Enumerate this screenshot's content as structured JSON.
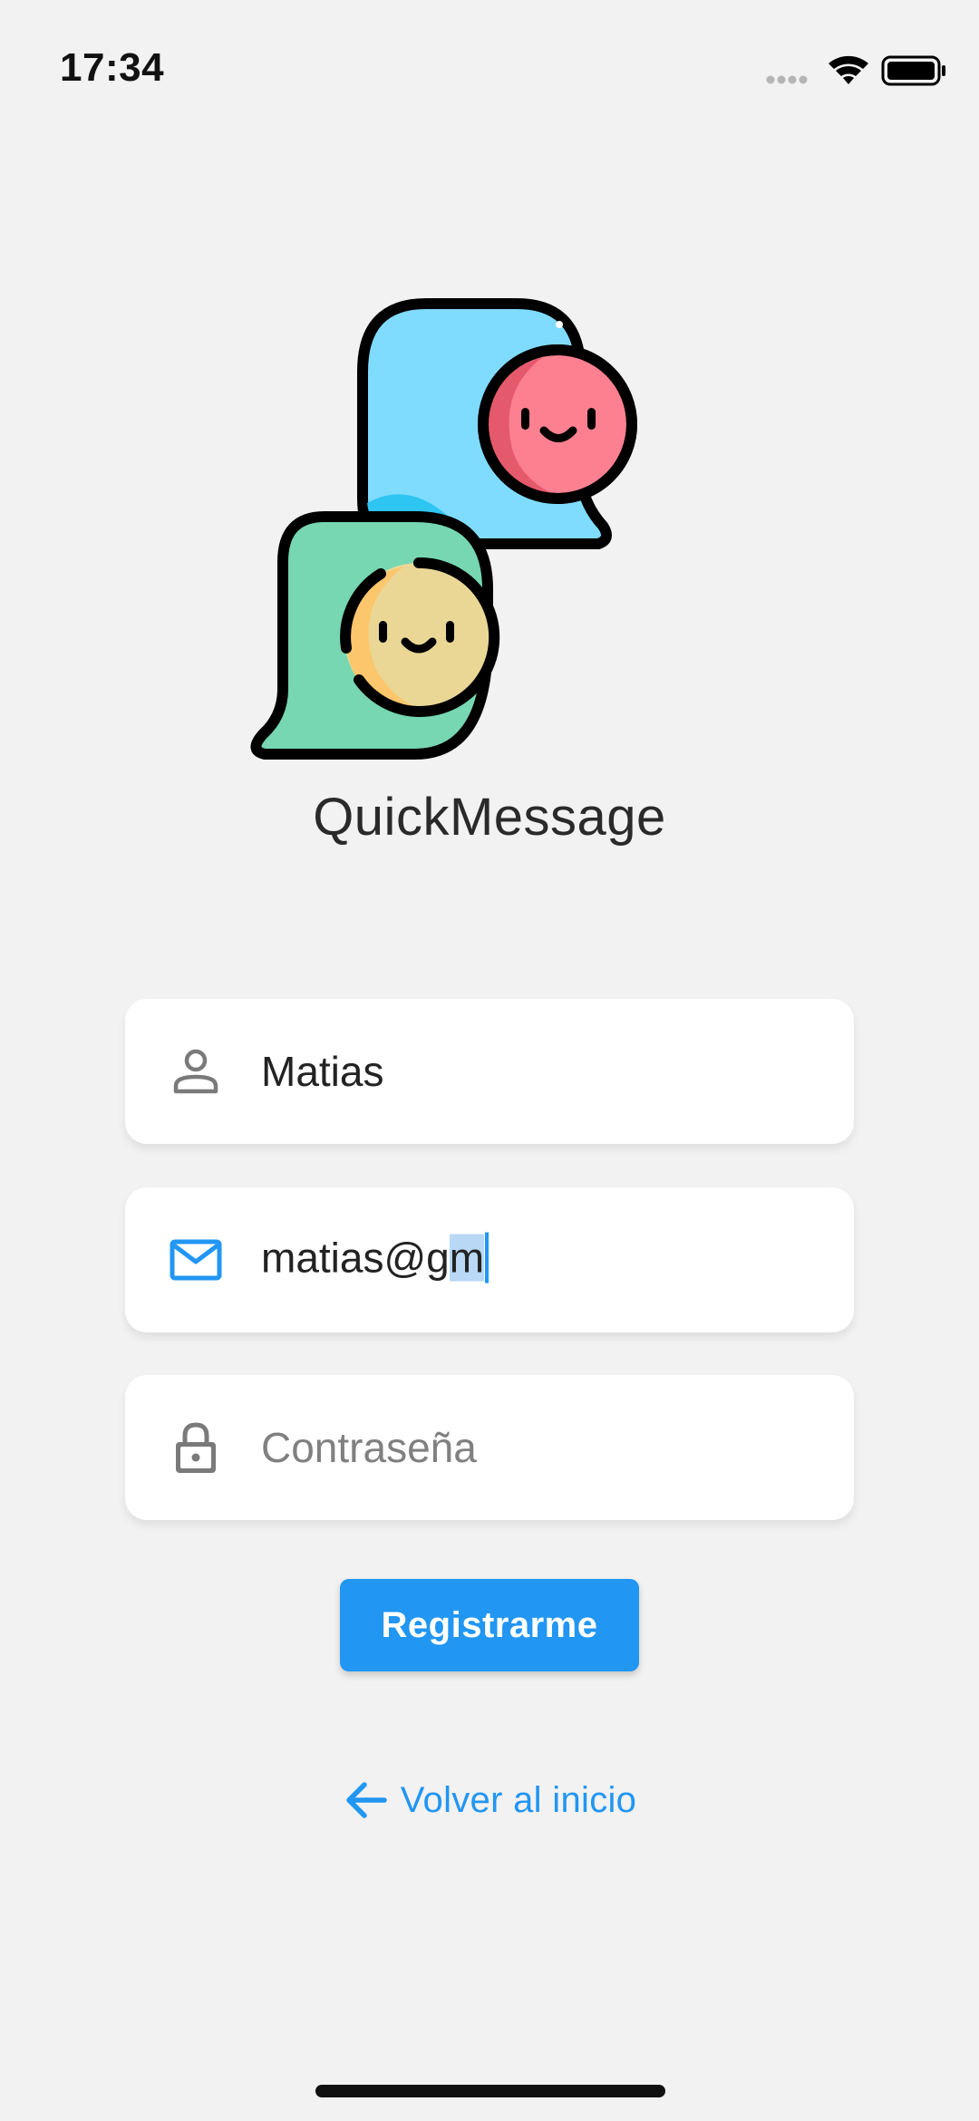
{
  "status_bar": {
    "time": "17:34",
    "icons": [
      "signal-dots-icon",
      "wifi-icon",
      "battery-icon"
    ]
  },
  "app": {
    "name": "QuickMessage",
    "logo": "chat-bubbles-smiley-logo"
  },
  "form": {
    "name_field": {
      "icon": "person-icon",
      "value": "Matias"
    },
    "email_field": {
      "icon": "mail-icon",
      "value_before_selection": "matias@g",
      "selected_text": "m"
    },
    "password_field": {
      "icon": "lock-icon",
      "placeholder": "Contraseña"
    },
    "register_label": "Registrarme"
  },
  "back_link": {
    "icon": "arrow-left-icon",
    "label": "Volver al inicio"
  },
  "colors": {
    "background": "#f2f2f2",
    "accent": "#2196f3",
    "bubble_blue": "#80dcff",
    "bubble_green": "#76d7b2",
    "face_pink": "#fd8091",
    "face_yellow": "#ead795"
  }
}
